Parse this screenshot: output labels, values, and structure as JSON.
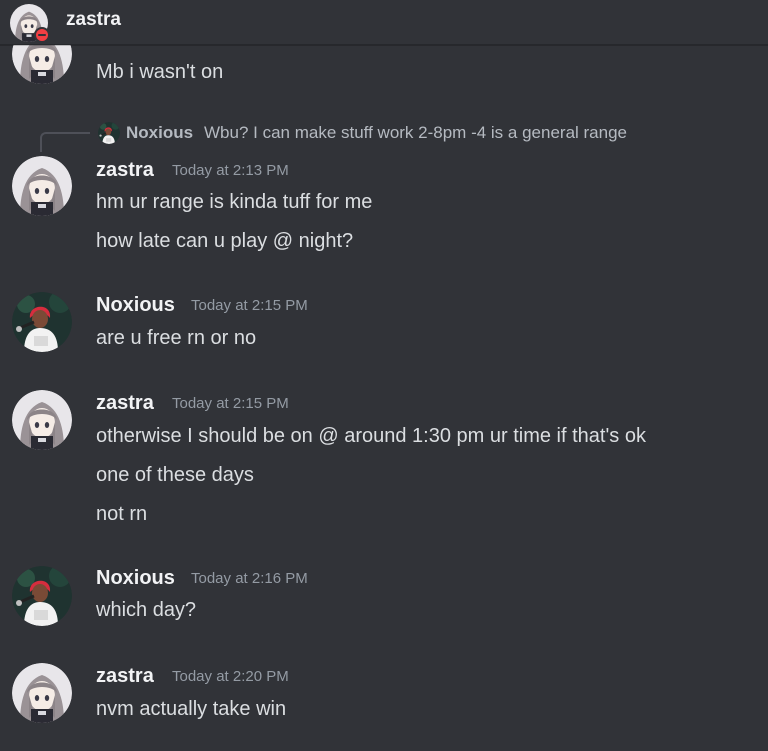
{
  "header": {
    "title": "zastra",
    "status": "dnd"
  },
  "colors": {
    "background": "#313338",
    "username": "#f2f3f5",
    "timestamp": "#949ba4",
    "text": "#dbdee1",
    "dnd": "#f23f43"
  },
  "messages": [
    {
      "type": "continuation",
      "lines": [
        "Mb i wasn't on"
      ]
    },
    {
      "author": "zastra",
      "time": "Today at 2:13 PM",
      "reply": {
        "author": "Noxious",
        "text": "Wbu? I can make stuff work 2-8pm -4 is a general range"
      },
      "lines": [
        "hm ur range is kinda tuff for me",
        "how late can u play @ night?"
      ]
    },
    {
      "author": "Noxious",
      "time": "Today at 2:15 PM",
      "lines": [
        "are u free rn or no"
      ]
    },
    {
      "author": "zastra",
      "time": "Today at 2:15 PM",
      "lines": [
        "otherwise I should be on @ around 1:30 pm ur time if that's ok",
        "one of these days",
        "not rn"
      ]
    },
    {
      "author": "Noxious",
      "time": "Today at 2:16 PM",
      "lines": [
        "which day?"
      ]
    },
    {
      "author": "zastra",
      "time": "Today at 2:20 PM",
      "lines": [
        "nvm actually take win"
      ]
    }
  ]
}
